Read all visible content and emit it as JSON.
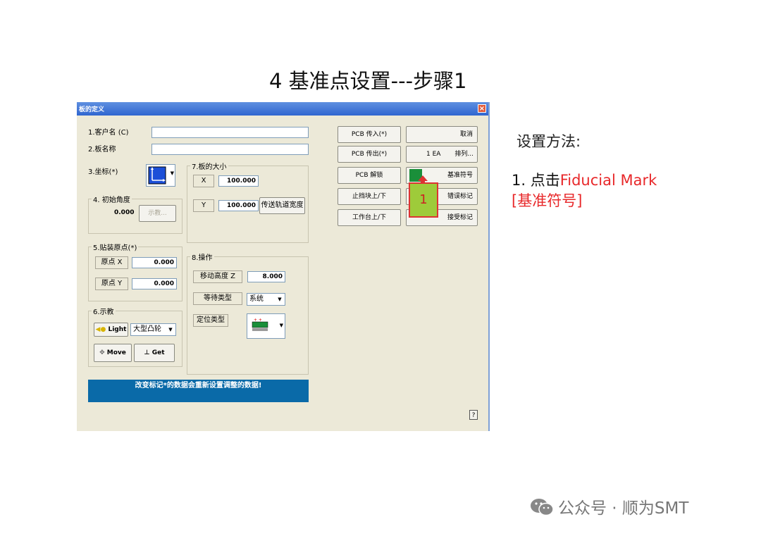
{
  "slide": {
    "title": "4 基准点设置---步骤1",
    "side_heading": "设置方法:",
    "step_prefix": "1. 点击",
    "step_highlight_1": "Fiducial  Mark",
    "step_highlight_2": "[基准符号]",
    "watermark": "公众号 · 顺为SMT"
  },
  "dialog": {
    "title": "板的定义",
    "close_label": "×",
    "customer_label": "1.客户名 (C)",
    "board_label": "2.板名称",
    "coord_label": "3.坐标(*)",
    "group4_title": "4. 初始角度",
    "init_angle": "0.000",
    "teach_btn": "示教...",
    "group7_title": "7.板的大小",
    "x_label": "X",
    "x_value": "100.000",
    "y_label": "Y",
    "y_value": "100.000",
    "conveyor_btn": "传送轨道宽度",
    "group5_title": "5.贴装原点(*)",
    "origin_x_label": "原点 X",
    "origin_x_value": "0.000",
    "origin_y_label": "原点 Y",
    "origin_y_value": "0.000",
    "group8_title": "8.操作",
    "move_height_label": "移动高度 Z",
    "move_height_value": "8.000",
    "wait_type_label": "等待类型",
    "wait_type_value": "系统",
    "locate_type_label": "定位类型",
    "group6_title": "6.示教",
    "light_btn": "Light",
    "cam_select": "大型凸轮",
    "move_btn": "Move",
    "get_btn": "Get",
    "notice": "改变标记*的数据会重新设置调整的数据!",
    "help": "?",
    "buttons_left": [
      "PCB 传入(*)",
      "PCB 传出(*)",
      "PCB 解锁",
      "止挡块上/下",
      "工作台上/下"
    ],
    "cancel": "取消",
    "ea_label": "1 EA",
    "array_btn": "排列...",
    "fiducial_btn": "基准符号",
    "bad_mark_btn": "错误标记",
    "accept_mark_btn": "接受标记",
    "callout_number": "1"
  }
}
